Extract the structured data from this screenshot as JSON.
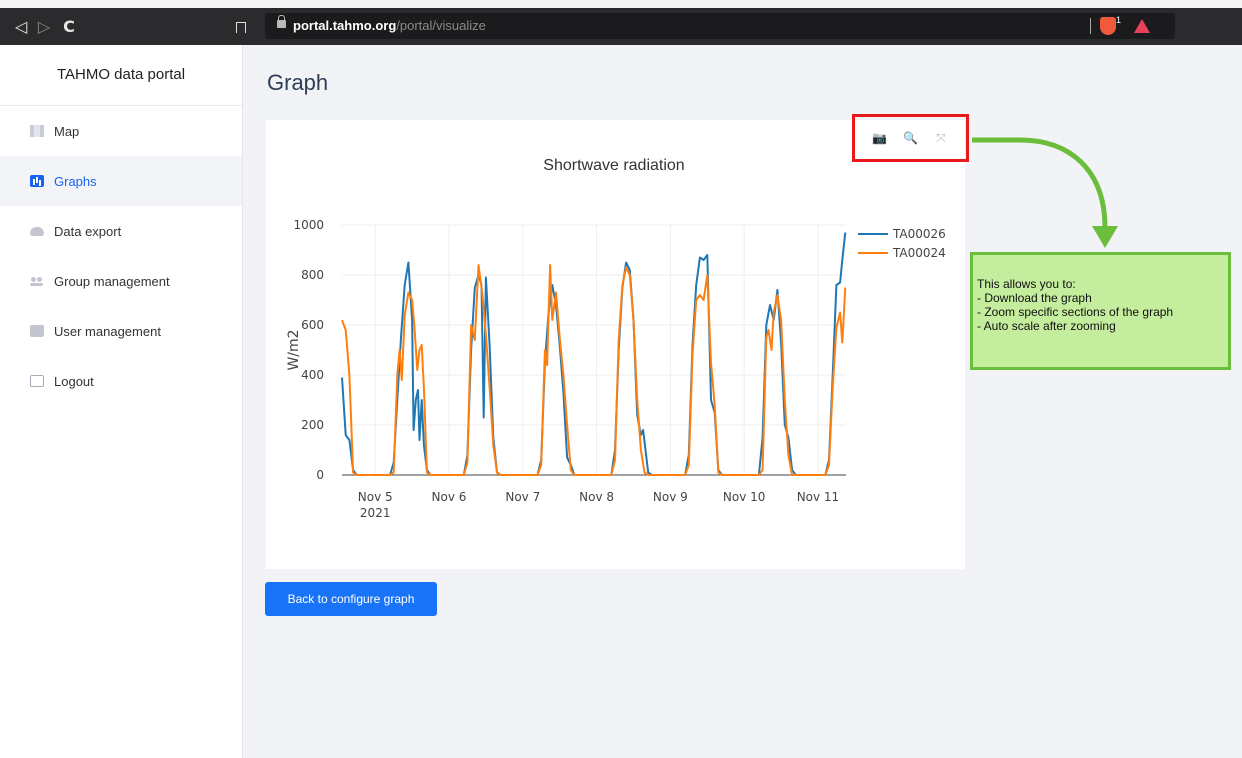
{
  "browser": {
    "url_host": "portal.tahmo.org",
    "url_path": "/portal/visualize",
    "nav_back": "◁",
    "nav_forward": "▷",
    "nav_reload": "C",
    "brave_count": "1"
  },
  "sidebar": {
    "brand": "TAHMO data portal",
    "items": [
      {
        "label": "Map",
        "icon": "map-icon"
      },
      {
        "label": "Graphs",
        "icon": "bar-chart-icon"
      },
      {
        "label": "Data export",
        "icon": "cloud-icon"
      },
      {
        "label": "Group management",
        "icon": "group-icon"
      },
      {
        "label": "User management",
        "icon": "user-icon"
      },
      {
        "label": "Logout",
        "icon": "logout-icon"
      }
    ],
    "active": "Graphs"
  },
  "page": {
    "title": "Graph",
    "back_button": "Back to configure graph"
  },
  "modebar": {
    "icons": [
      "camera-icon",
      "zoom-icon",
      "autoscale-icon"
    ]
  },
  "annotation": {
    "text": "This allows you to:\n- Download the graph\n- Zoom specific sections of the graph\n- Auto scale after zooming",
    "box_color": "#c4ed9e",
    "border_color": "#6bbd3c",
    "highlight_color": "#e8181c"
  },
  "chart_data": {
    "type": "line",
    "title": "Shortwave radiation",
    "ylabel": "W/m2",
    "xlabel": "",
    "ylim": [
      0,
      1000
    ],
    "yticks": [
      0,
      200,
      400,
      600,
      800,
      1000
    ],
    "xticks": [
      {
        "day": 5,
        "label": "Nov 5",
        "sub": "2021"
      },
      {
        "day": 6,
        "label": "Nov 6"
      },
      {
        "day": 7,
        "label": "Nov 7"
      },
      {
        "day": 8,
        "label": "Nov 8"
      },
      {
        "day": 9,
        "label": "Nov 9"
      },
      {
        "day": 10,
        "label": "Nov 10"
      },
      {
        "day": 11,
        "label": "Nov 11"
      }
    ],
    "xlim": [
      4.55,
      11.38
    ],
    "legend": "top-right",
    "grid": true,
    "series": [
      {
        "name": "TA00026",
        "color": "#1f77b4",
        "points": [
          [
            4.55,
            390
          ],
          [
            4.6,
            160
          ],
          [
            4.65,
            140
          ],
          [
            4.7,
            20
          ],
          [
            4.75,
            0
          ],
          [
            5.2,
            0
          ],
          [
            5.25,
            50
          ],
          [
            5.3,
            300
          ],
          [
            5.35,
            550
          ],
          [
            5.4,
            760
          ],
          [
            5.45,
            850
          ],
          [
            5.5,
            620
          ],
          [
            5.52,
            180
          ],
          [
            5.55,
            300
          ],
          [
            5.58,
            340
          ],
          [
            5.6,
            140
          ],
          [
            5.63,
            300
          ],
          [
            5.66,
            120
          ],
          [
            5.7,
            20
          ],
          [
            5.75,
            0
          ],
          [
            6.2,
            0
          ],
          [
            6.25,
            80
          ],
          [
            6.3,
            500
          ],
          [
            6.35,
            750
          ],
          [
            6.4,
            800
          ],
          [
            6.44,
            760
          ],
          [
            6.47,
            230
          ],
          [
            6.5,
            790
          ],
          [
            6.55,
            520
          ],
          [
            6.6,
            150
          ],
          [
            6.65,
            10
          ],
          [
            6.7,
            0
          ],
          [
            7.2,
            0
          ],
          [
            7.25,
            60
          ],
          [
            7.3,
            450
          ],
          [
            7.35,
            650
          ],
          [
            7.4,
            760
          ],
          [
            7.45,
            680
          ],
          [
            7.5,
            520
          ],
          [
            7.55,
            330
          ],
          [
            7.6,
            70
          ],
          [
            7.65,
            40
          ],
          [
            7.7,
            0
          ],
          [
            8.2,
            0
          ],
          [
            8.25,
            100
          ],
          [
            8.3,
            500
          ],
          [
            8.35,
            750
          ],
          [
            8.4,
            850
          ],
          [
            8.45,
            820
          ],
          [
            8.5,
            620
          ],
          [
            8.55,
            240
          ],
          [
            8.6,
            160
          ],
          [
            8.63,
            180
          ],
          [
            8.7,
            10
          ],
          [
            8.75,
            0
          ],
          [
            9.2,
            0
          ],
          [
            9.25,
            80
          ],
          [
            9.3,
            520
          ],
          [
            9.35,
            760
          ],
          [
            9.4,
            870
          ],
          [
            9.45,
            860
          ],
          [
            9.5,
            880
          ],
          [
            9.55,
            300
          ],
          [
            9.6,
            250
          ],
          [
            9.65,
            20
          ],
          [
            9.7,
            0
          ],
          [
            10.2,
            0
          ],
          [
            10.25,
            150
          ],
          [
            10.3,
            600
          ],
          [
            10.35,
            680
          ],
          [
            10.4,
            620
          ],
          [
            10.45,
            740
          ],
          [
            10.5,
            530
          ],
          [
            10.55,
            200
          ],
          [
            10.6,
            150
          ],
          [
            10.65,
            20
          ],
          [
            10.7,
            0
          ],
          [
            11.1,
            0
          ],
          [
            11.15,
            60
          ],
          [
            11.2,
            400
          ],
          [
            11.25,
            760
          ],
          [
            11.3,
            770
          ],
          [
            11.33,
            860
          ],
          [
            11.37,
            970
          ]
        ]
      },
      {
        "name": "TA00024",
        "color": "#ff7f0e",
        "points": [
          [
            4.55,
            620
          ],
          [
            4.6,
            580
          ],
          [
            4.65,
            400
          ],
          [
            4.7,
            10
          ],
          [
            4.75,
            0
          ],
          [
            5.2,
            0
          ],
          [
            5.25,
            10
          ],
          [
            5.3,
            400
          ],
          [
            5.33,
            500
          ],
          [
            5.36,
            380
          ],
          [
            5.4,
            640
          ],
          [
            5.45,
            730
          ],
          [
            5.5,
            700
          ],
          [
            5.53,
            600
          ],
          [
            5.57,
            420
          ],
          [
            5.6,
            500
          ],
          [
            5.63,
            520
          ],
          [
            5.66,
            350
          ],
          [
            5.7,
            10
          ],
          [
            5.75,
            0
          ],
          [
            6.2,
            0
          ],
          [
            6.25,
            50
          ],
          [
            6.3,
            600
          ],
          [
            6.35,
            540
          ],
          [
            6.4,
            840
          ],
          [
            6.45,
            730
          ],
          [
            6.5,
            560
          ],
          [
            6.55,
            350
          ],
          [
            6.6,
            120
          ],
          [
            6.65,
            10
          ],
          [
            6.7,
            0
          ],
          [
            7.2,
            0
          ],
          [
            7.25,
            40
          ],
          [
            7.3,
            500
          ],
          [
            7.33,
            440
          ],
          [
            7.37,
            840
          ],
          [
            7.4,
            620
          ],
          [
            7.45,
            730
          ],
          [
            7.5,
            550
          ],
          [
            7.55,
            400
          ],
          [
            7.6,
            200
          ],
          [
            7.65,
            20
          ],
          [
            7.7,
            0
          ],
          [
            8.2,
            0
          ],
          [
            8.25,
            60
          ],
          [
            8.3,
            540
          ],
          [
            8.35,
            760
          ],
          [
            8.4,
            830
          ],
          [
            8.45,
            800
          ],
          [
            8.5,
            620
          ],
          [
            8.55,
            300
          ],
          [
            8.6,
            100
          ],
          [
            8.65,
            10
          ],
          [
            8.7,
            0
          ],
          [
            9.2,
            0
          ],
          [
            9.25,
            40
          ],
          [
            9.3,
            480
          ],
          [
            9.35,
            700
          ],
          [
            9.4,
            720
          ],
          [
            9.45,
            700
          ],
          [
            9.5,
            800
          ],
          [
            9.55,
            450
          ],
          [
            9.6,
            280
          ],
          [
            9.65,
            10
          ],
          [
            9.7,
            0
          ],
          [
            10.2,
            0
          ],
          [
            10.25,
            20
          ],
          [
            10.3,
            550
          ],
          [
            10.33,
            580
          ],
          [
            10.37,
            500
          ],
          [
            10.4,
            650
          ],
          [
            10.45,
            720
          ],
          [
            10.5,
            620
          ],
          [
            10.55,
            300
          ],
          [
            10.6,
            80
          ],
          [
            10.65,
            0
          ],
          [
            11.1,
            0
          ],
          [
            11.15,
            40
          ],
          [
            11.2,
            350
          ],
          [
            11.25,
            590
          ],
          [
            11.3,
            650
          ],
          [
            11.33,
            530
          ],
          [
            11.37,
            750
          ]
        ]
      }
    ]
  }
}
